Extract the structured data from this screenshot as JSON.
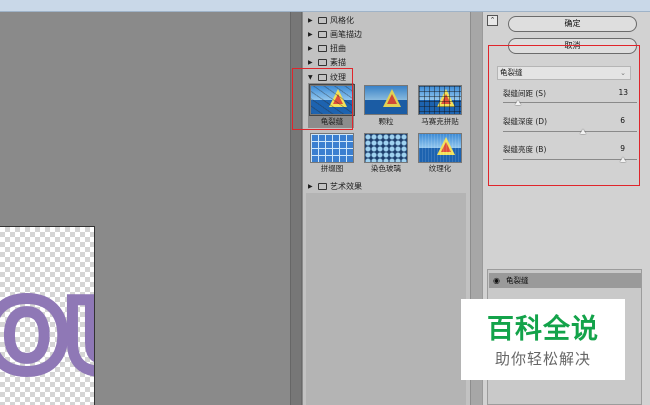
{
  "gallery": {
    "categories": [
      {
        "label": "风格化",
        "expanded": false
      },
      {
        "label": "画笔描边",
        "expanded": false
      },
      {
        "label": "扭曲",
        "expanded": false
      },
      {
        "label": "素描",
        "expanded": false
      },
      {
        "label": "纹理",
        "expanded": true
      },
      {
        "label": "艺术效果",
        "expanded": false
      }
    ],
    "texture_filters": [
      {
        "label": "龟裂缝",
        "selected": true
      },
      {
        "label": "颗粒",
        "selected": false
      },
      {
        "label": "马赛克拼贴",
        "selected": false
      },
      {
        "label": "拼缀图",
        "selected": false
      },
      {
        "label": "染色玻璃",
        "selected": false
      },
      {
        "label": "纹理化",
        "selected": false
      }
    ]
  },
  "buttons": {
    "ok": "确定",
    "cancel": "取消"
  },
  "filter_select": {
    "value": "龟裂缝"
  },
  "params": [
    {
      "label": "裂缝间距 (S)",
      "value": "13",
      "min": 2,
      "max": 100
    },
    {
      "label": "裂缝深度 (D)",
      "value": "6",
      "min": 0,
      "max": 10
    },
    {
      "label": "裂缝亮度 (B)",
      "value": "9",
      "min": 0,
      "max": 10
    }
  ],
  "layers": {
    "items": [
      {
        "label": "龟裂缝"
      }
    ]
  },
  "watermark": {
    "title": "百科全说",
    "subtitle": "助你轻松解决"
  },
  "preview": {
    "letters": "OU"
  },
  "colors": {
    "accent_red": "#e0252b",
    "watermark_green": "#13a34a",
    "letter_purple": "#8f78b6"
  },
  "icons": {
    "expand_collapsed": "triangle-right",
    "expand_open": "triangle-down",
    "folder": "folder-icon",
    "visibility": "eye-icon"
  }
}
